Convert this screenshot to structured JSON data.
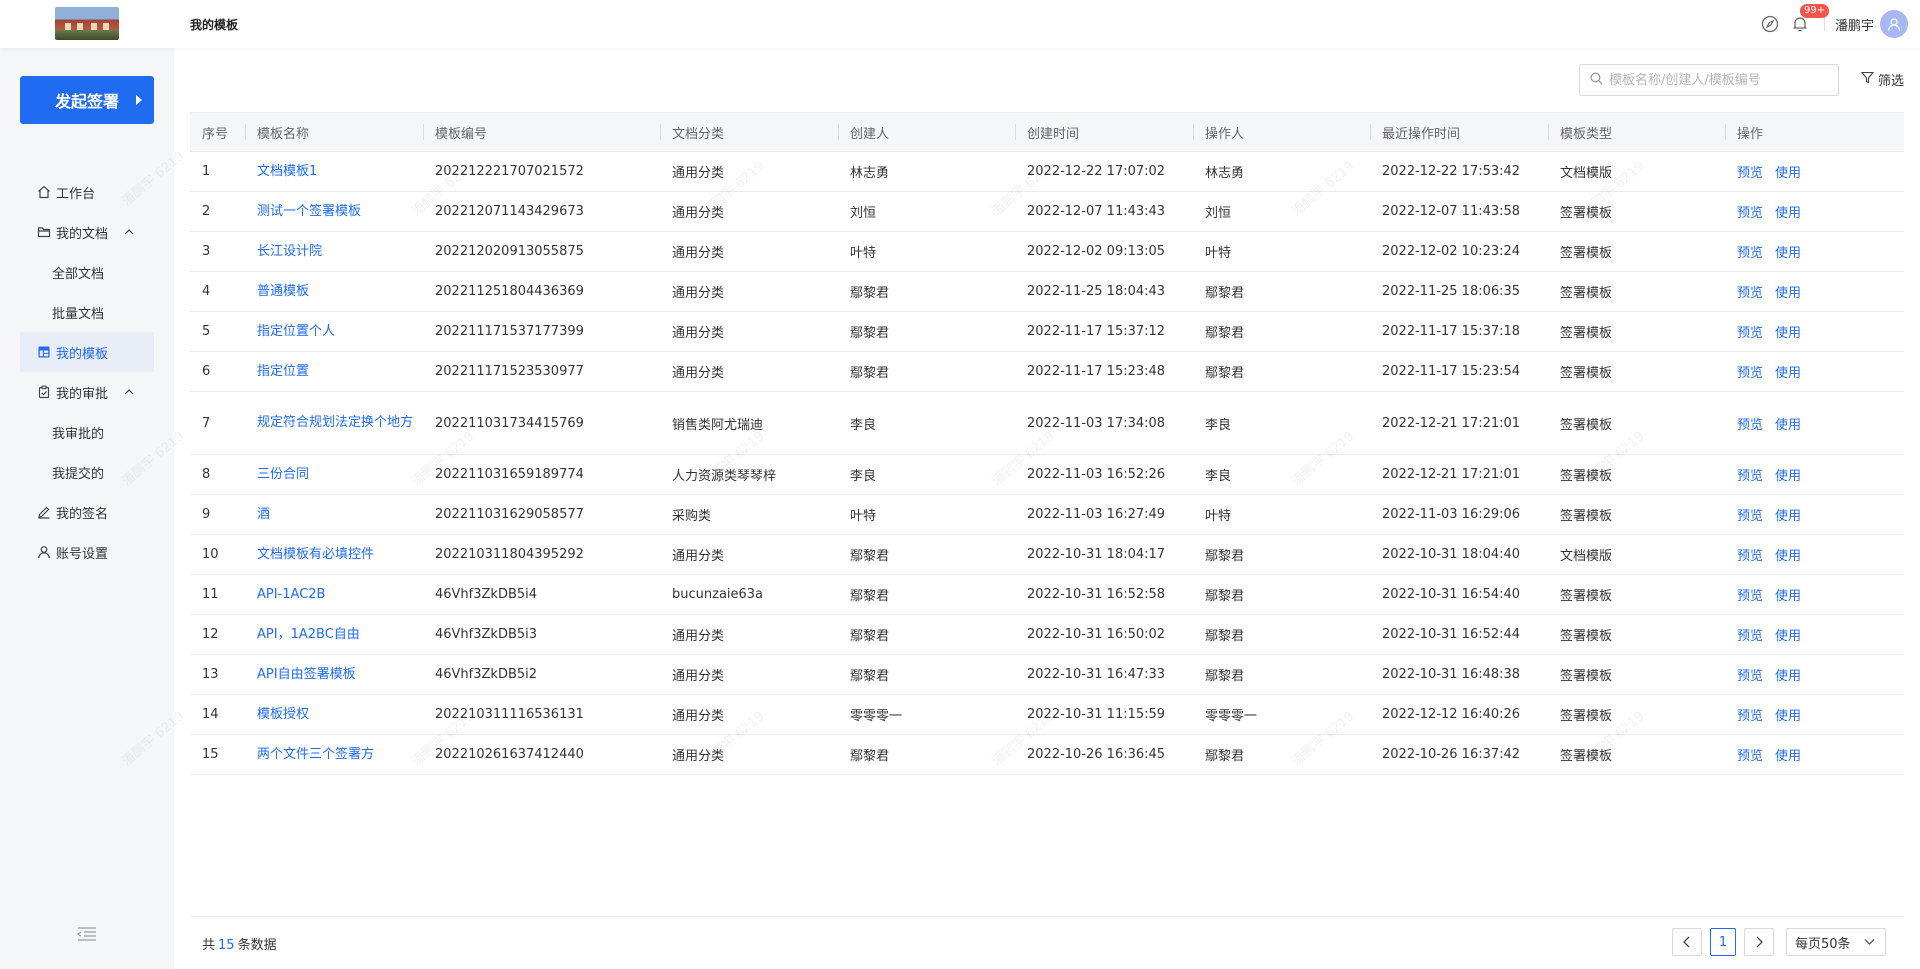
{
  "header": {
    "page_title": "我的模板",
    "notification_count": "99+",
    "username": "潘鹏宇"
  },
  "sidebar": {
    "start_button": "发起签署",
    "items": [
      {
        "label": "工作台",
        "icon": "home-icon"
      },
      {
        "label": "我的文档",
        "icon": "folder-icon",
        "expanded": true
      },
      {
        "label": "全部文档",
        "sub": true
      },
      {
        "label": "批量文档",
        "sub": true
      },
      {
        "label": "我的模板",
        "icon": "template-icon",
        "active": true
      },
      {
        "label": "我的审批",
        "icon": "approval-icon",
        "expanded": true
      },
      {
        "label": "我审批的",
        "sub": true
      },
      {
        "label": "我提交的",
        "sub": true
      },
      {
        "label": "我的签名",
        "icon": "pen-icon"
      },
      {
        "label": "账号设置",
        "icon": "user-icon"
      }
    ]
  },
  "toolbar": {
    "search_placeholder": "模板名称/创建人/模板编号",
    "filter_label": "筛选"
  },
  "table": {
    "headers": [
      "序号",
      "模板名称",
      "模板编号",
      "文档分类",
      "创建人",
      "创建时间",
      "操作人",
      "最近操作时间",
      "模板类型",
      "操作"
    ],
    "action_preview": "预览",
    "action_use": "使用",
    "rows": [
      {
        "no": "1",
        "name": "文档模板1",
        "code": "202212221707021572",
        "category": "通用分类",
        "creator": "林志勇",
        "created": "2022-12-22 17:07:02",
        "operator": "林志勇",
        "updated": "2022-12-22 17:53:42",
        "type": "文档模版"
      },
      {
        "no": "2",
        "name": "测试一个签署模板",
        "code": "202212071143429673",
        "category": "通用分类",
        "creator": "刘恒",
        "created": "2022-12-07 11:43:43",
        "operator": "刘恒",
        "updated": "2022-12-07 11:43:58",
        "type": "签署模板"
      },
      {
        "no": "3",
        "name": "长江设计院",
        "code": "202212020913055875",
        "category": "通用分类",
        "creator": "叶特",
        "created": "2022-12-02 09:13:05",
        "operator": "叶特",
        "updated": "2022-12-02 10:23:24",
        "type": "签署模板"
      },
      {
        "no": "4",
        "name": "普通模板",
        "code": "202211251804436369",
        "category": "通用分类",
        "creator": "鄢黎君",
        "created": "2022-11-25 18:04:43",
        "operator": "鄢黎君",
        "updated": "2022-11-25 18:06:35",
        "type": "签署模板"
      },
      {
        "no": "5",
        "name": "指定位置个人",
        "code": "202211171537177399",
        "category": "通用分类",
        "creator": "鄢黎君",
        "created": "2022-11-17 15:37:12",
        "operator": "鄢黎君",
        "updated": "2022-11-17 15:37:18",
        "type": "签署模板"
      },
      {
        "no": "6",
        "name": "指定位置",
        "code": "202211171523530977",
        "category": "通用分类",
        "creator": "鄢黎君",
        "created": "2022-11-17 15:23:48",
        "operator": "鄢黎君",
        "updated": "2022-11-17 15:23:54",
        "type": "签署模板"
      },
      {
        "no": "7",
        "name": "规定符合规划法定换个地方",
        "code": "202211031734415769",
        "category": "销售类阿尤瑞迪",
        "creator": "李良",
        "created": "2022-11-03 17:34:08",
        "operator": "李良",
        "updated": "2022-12-21 17:21:01",
        "type": "签署模板",
        "tall": true
      },
      {
        "no": "8",
        "name": "三份合同",
        "code": "202211031659189774",
        "category": "人力资源类琴琴梓",
        "creator": "李良",
        "created": "2022-11-03 16:52:26",
        "operator": "李良",
        "updated": "2022-12-21 17:21:01",
        "type": "签署模板"
      },
      {
        "no": "9",
        "name": "酒",
        "code": "202211031629058577",
        "category": "采购类",
        "creator": "叶特",
        "created": "2022-11-03 16:27:49",
        "operator": "叶特",
        "updated": "2022-11-03 16:29:06",
        "type": "签署模板"
      },
      {
        "no": "10",
        "name": "文档模板有必填控件",
        "code": "202210311804395292",
        "category": "通用分类",
        "creator": "鄢黎君",
        "created": "2022-10-31 18:04:17",
        "operator": "鄢黎君",
        "updated": "2022-10-31 18:04:40",
        "type": "文档模版"
      },
      {
        "no": "11",
        "name": "API-1AC2B",
        "code": "46Vhf3ZkDB5i4",
        "category": "bucunzaie63a",
        "creator": "鄢黎君",
        "created": "2022-10-31 16:52:58",
        "operator": "鄢黎君",
        "updated": "2022-10-31 16:54:40",
        "type": "签署模板"
      },
      {
        "no": "12",
        "name": "API，1A2BC自由",
        "code": "46Vhf3ZkDB5i3",
        "category": "通用分类",
        "creator": "鄢黎君",
        "created": "2022-10-31 16:50:02",
        "operator": "鄢黎君",
        "updated": "2022-10-31 16:52:44",
        "type": "签署模板"
      },
      {
        "no": "13",
        "name": "API自由签署模板",
        "code": "46Vhf3ZkDB5i2",
        "category": "通用分类",
        "creator": "鄢黎君",
        "created": "2022-10-31 16:47:33",
        "operator": "鄢黎君",
        "updated": "2022-10-31 16:48:38",
        "type": "签署模板"
      },
      {
        "no": "14",
        "name": "模板授权",
        "code": "202210311116536131",
        "category": "通用分类",
        "creator": "零零零一",
        "created": "2022-10-31 11:15:59",
        "operator": "零零零一",
        "updated": "2022-12-12 16:40:26",
        "type": "签署模板"
      },
      {
        "no": "15",
        "name": "两个文件三个签署方",
        "code": "202210261637412440",
        "category": "通用分类",
        "creator": "鄢黎君",
        "created": "2022-10-26 16:36:45",
        "operator": "鄢黎君",
        "updated": "2022-10-26 16:37:42",
        "type": "签署模板"
      }
    ]
  },
  "footer": {
    "total_prefix": "共",
    "total_count": "15",
    "total_suffix": "条数据",
    "current_page": "1",
    "page_size": "每页50条"
  },
  "watermark": "潘鹏宇 6219",
  "colors": {
    "accent": "#1f6bf2",
    "badge": "#f5544d"
  }
}
